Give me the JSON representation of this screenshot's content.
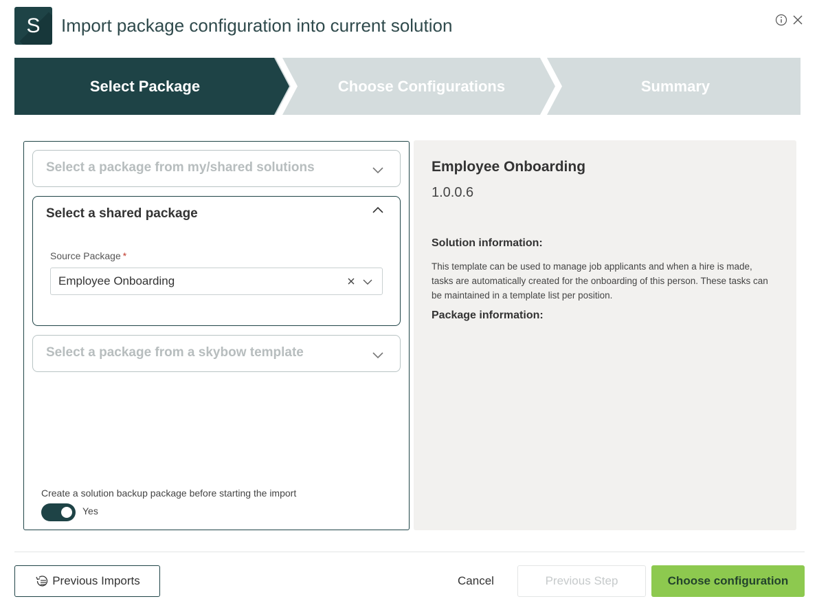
{
  "app": {
    "logo_letter": "S",
    "title": "Import package configuration into current solution",
    "info_icon": "info-icon",
    "close_icon": "close-icon"
  },
  "stepper": {
    "steps": [
      {
        "label": "Select Package",
        "state": "active"
      },
      {
        "label": "Choose Configurations",
        "state": "inactive"
      },
      {
        "label": "Summary",
        "state": "inactive"
      }
    ],
    "colors": {
      "active": "#1e4346",
      "inactive": "#d4dcdd",
      "text": "#ffffff"
    }
  },
  "left": {
    "accordions": [
      {
        "title": "Select a package from my/shared solutions",
        "expanded": false
      },
      {
        "title": "Select a shared package",
        "expanded": true
      },
      {
        "title": "Select a package from a skybow template",
        "expanded": false
      }
    ],
    "source_package": {
      "label": "Source Package",
      "required_marker": "*",
      "value": "Employee Onboarding"
    },
    "backup": {
      "label": "Create a solution backup package before starting the import",
      "toggle_on": true,
      "toggle_text": "Yes"
    }
  },
  "right": {
    "package_name": "Employee Onboarding",
    "version": "1.0.0.6",
    "solution_info_heading": "Solution information:",
    "solution_info_text": "This template can be used to manage job applicants and when a hire is made, tasks are automatically created for the onboarding of this person. These tasks can be maintained in a template list per position.",
    "package_info_heading": "Package information:"
  },
  "footer": {
    "previous_imports": "Previous Imports",
    "cancel": "Cancel",
    "previous_step": "Previous Step",
    "choose_configuration": "Choose configuration",
    "accent_color": "#8dc94f"
  }
}
